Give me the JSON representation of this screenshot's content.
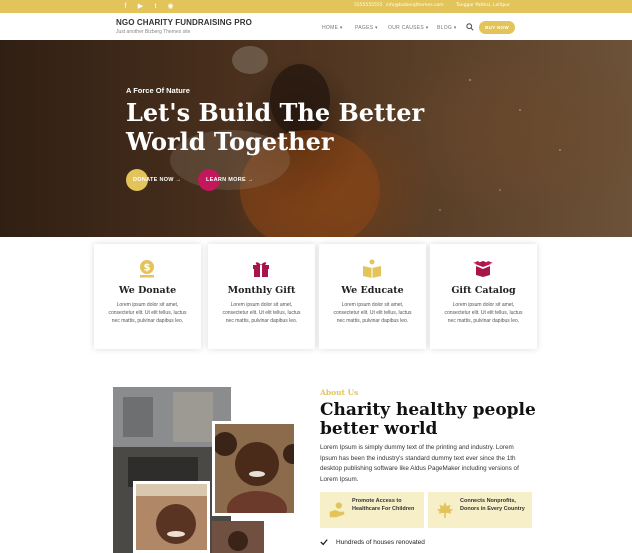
{
  "topbar": {
    "social_icons": [
      "facebook-icon",
      "youtube-icon",
      "twitter-icon",
      "instagram-icon"
    ],
    "phone": "5555555555",
    "email": "info@bizberqthemes.com",
    "address": "Tanggar Pathisi, Lalitpur"
  },
  "header": {
    "site_title": "NGO CHARITY FUNDRAISING PRO",
    "tagline": "Just another Bizberg Themes site",
    "nav": [
      "HOME",
      "PAGES",
      "OUR CAUSES",
      "BLOG"
    ],
    "buy_now": "BUY NOW"
  },
  "hero": {
    "subtitle": "A Force Of Nature",
    "title": "Let's Build The Better World Together",
    "donate_label": "DONATE NOW →",
    "learn_label": "LEARN MORE →"
  },
  "cards": [
    {
      "title": "We Donate",
      "icon": "dollar-icon",
      "text": "Lorem ipsum dolor sit amet, consectetur elit. Ut elit tellus, luctus nec mattis, pulvinar dapibus leo."
    },
    {
      "title": "Monthly Gift",
      "icon": "gift-icon",
      "text": "Lorem ipsum dolor sit amet, consectetur elit. Ut elit tellus, luctus nec mattis, pulvinar dapibus leo."
    },
    {
      "title": "We Educate",
      "icon": "book-icon",
      "text": "Lorem ipsum dolor sit amet, consectetur elit. Ut elit tellus, luctus nec mattis, pulvinar dapibus leo."
    },
    {
      "title": "Gift Catalog",
      "icon": "box-icon",
      "text": "Lorem ipsum dolor sit amet, consectetur elit. Ut elit tellus, luctus nec mattis, pulvinar dapibus leo."
    }
  ],
  "about": {
    "eyebrow": "About Us",
    "title": "Charity healthy people better world",
    "text": "Lorem Ipsum is simply dummy text of the printing and industry. Lorem Ipsum has been the industry's standard dummy text ever since the 1th desktop publishing software like Aldus PageMaker including versions of Lorem Ipsum.",
    "features": [
      {
        "label": "Promote Access to Healthcare For Children",
        "icon": "hands-icon"
      },
      {
        "label": "Connects Nonprofits, Donors in Every Country",
        "icon": "maple-leaf-icon"
      }
    ],
    "checklist": [
      "Hundreds of houses renovated"
    ]
  },
  "colors": {
    "accent": "#e2c45b",
    "secondary": "#c2185b",
    "feature_bg": "#f7efc7"
  }
}
